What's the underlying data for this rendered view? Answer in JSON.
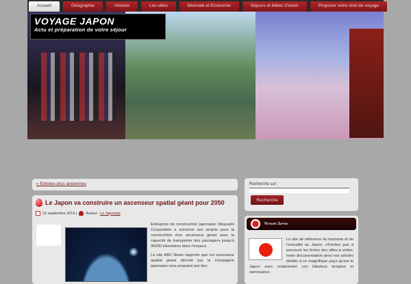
{
  "nav": {
    "tabs": [
      "Accueil",
      "Géographie",
      "Histoire",
      "Les villes",
      "Monnaie et Economie",
      "Séjours et billets d'avion",
      "Proposer votre récit de voyage"
    ]
  },
  "banner": {
    "title": "VOYAGE JAPON",
    "subtitle": "Actu et préparation de votre séjour"
  },
  "older_link": "« Entrées plus anciennes",
  "post": {
    "title": "Le Japon va construire un ascenseur spatial géant pour 2050",
    "date": "22 septembre 2014 |",
    "author_label": "Auteur:",
    "author": "Le Japonais",
    "p1": "Entreprise de construction japonaise Obayashi Corporation a annoncé ses projets pour la construction d'un ascenseur géant avec la capacité de transporter des passagers jusqu'à 96000 kilomètres dans l'espace.",
    "p2": "Le site ABC News rapporte que cet ascenseur spatial géant dévoilé par la compagnie japonaise sera propulsé par des"
  },
  "search": {
    "label": "Recherche sur :",
    "button": "Recherche"
  },
  "widget": {
    "title": "Voyage Japon",
    "text": "Le site de référence du tourisme et de l'actualité au Japon, n'hésitez pas à parcourir les fiches des villes à visiter, notre documentation ainsi nos articles dédiés à ce magnifique pays qu'est le Japon avec notamment ces fabuleux temples et sanctuaires"
  }
}
